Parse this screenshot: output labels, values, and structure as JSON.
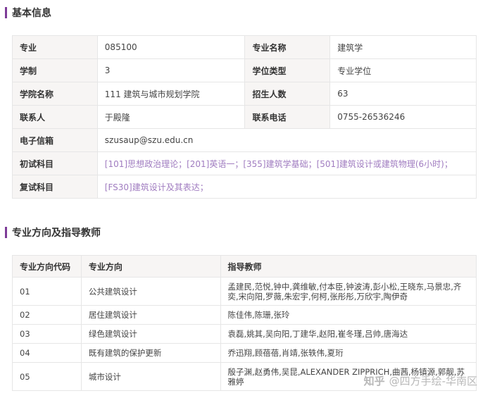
{
  "section1": {
    "title": "基本信息"
  },
  "info": {
    "row1": {
      "l1": "专业",
      "v1": "085100",
      "l2": "专业名称",
      "v2": "建筑学"
    },
    "row2": {
      "l1": "学制",
      "v1": "3",
      "l2": "学位类型",
      "v2": "专业学位"
    },
    "row3": {
      "l1": "学院名称",
      "v1": "111 建筑与城市规划学院",
      "l2": "招生人数",
      "v2": "63"
    },
    "row4": {
      "l1": "联系人",
      "v1": "于殿隆",
      "l2": "联系电话",
      "v2": "0755-26536246"
    },
    "row5": {
      "l1": "电子信箱",
      "v1": "szusaup@szu.edu.cn"
    },
    "row6": {
      "l1": "初试科目",
      "v1": "[101]思想政治理论；[201]英语一；[355]建筑学基础；[501]建筑设计或建筑物理(6小时)；"
    },
    "row7": {
      "l1": "复试科目",
      "v1": "[FS30]建筑设计及其表达；"
    }
  },
  "section2": {
    "title": "专业方向及指导教师"
  },
  "directions": {
    "headers": {
      "code": "专业方向代码",
      "name": "专业方向",
      "teachers": "指导教师"
    },
    "rows": [
      {
        "code": "01",
        "name": "公共建筑设计",
        "teachers": "孟建民,范悦,钟中,龚维敏,付本臣,钟波涛,彭小松,王晓东,马景忠,齐奕,宋向阳,罗薇,朱宏宇,何柯,张彤彤,万欣宇,陶伊奇"
      },
      {
        "code": "02",
        "name": "居住建筑设计",
        "teachers": "陈佳伟,陈珊,张玲"
      },
      {
        "code": "03",
        "name": "绿色建筑设计",
        "teachers": "袁磊,姚其,吴向阳,丁建华,赵阳,崔冬瑾,吕帅,唐海达"
      },
      {
        "code": "04",
        "name": "既有建筑的保护更新",
        "teachers": "乔迅翔,顾蓓蓓,肖靖,张轶伟,夏珩"
      },
      {
        "code": "05",
        "name": "城市设计",
        "teachers": "殷子渊,赵勇伟,吴昆,ALEXANDER ZIPPRICH,曲茜,杨镇源,郭靓,苏雅婷"
      }
    ]
  },
  "watermark": {
    "logo": "知乎",
    "text": "@四方手绘-华南区"
  }
}
